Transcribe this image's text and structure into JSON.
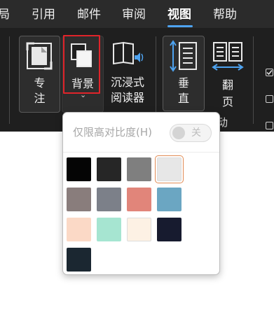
{
  "menu": {
    "tabs": [
      {
        "label": "布局",
        "partial": "局"
      },
      {
        "label": "引用"
      },
      {
        "label": "邮件"
      },
      {
        "label": "审阅"
      },
      {
        "label": "视图",
        "active": true
      },
      {
        "label": "帮助"
      }
    ],
    "tab_visible_text": [
      "局",
      "引用",
      "邮件",
      "审阅",
      "视图",
      "帮助"
    ]
  },
  "ribbon": {
    "focus_label_1": "专",
    "focus_label_2": "注",
    "background_label": "背景",
    "background_chevron": "⌄",
    "immersive_label_1": "沉浸式",
    "immersive_label_2": "阅读器",
    "vertical_label_1": "垂",
    "vertical_label_2": "直",
    "pageflip_label_1": "翻",
    "pageflip_label_2": "页",
    "group_suffix": "动"
  },
  "popup": {
    "high_contrast_label": "仅限高对比度(H)",
    "toggle_state": "关"
  },
  "colors": {
    "swatches": [
      "#050505",
      "#262626",
      "#7f7f7f",
      "#e7e7e7",
      "#897d7c",
      "#7c8089",
      "#e1857a",
      "#6ba6c2",
      "#fbd9c6",
      "#a6e5d1",
      "#fdf1e4",
      "#171b2f",
      "#1b2731"
    ],
    "selected_index": 3,
    "accent_selected": "#e28b54",
    "highlight_red": "#e0242a",
    "tab_underline": "#4ea3f0"
  }
}
